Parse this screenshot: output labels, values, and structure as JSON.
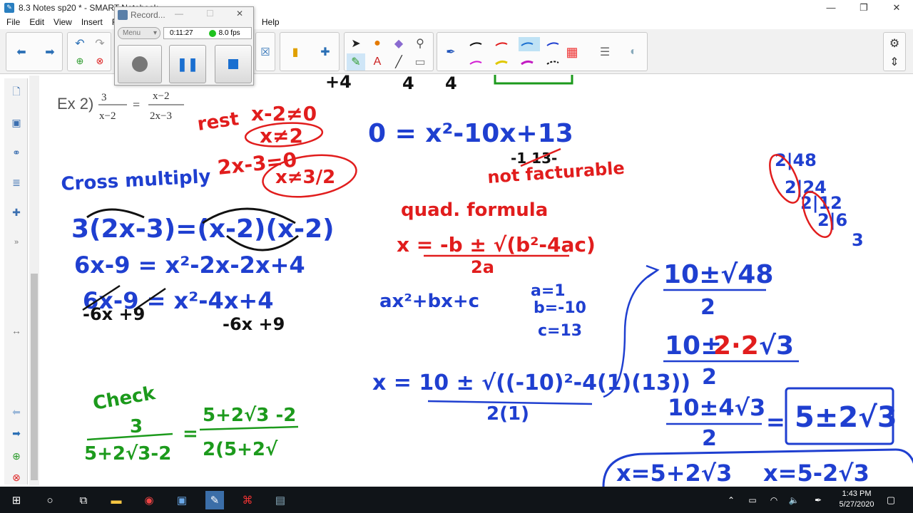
{
  "window": {
    "title": "8.3 Notes sp20 * - SMART Notebook",
    "minimize_glyph": "—",
    "maximize_glyph": "❐",
    "close_glyph": "✕"
  },
  "menu": [
    "File",
    "Edit",
    "View",
    "Insert",
    "Fo",
    "Help"
  ],
  "recorder": {
    "title": "Record...",
    "menu_label": "Menu",
    "time": "0:11:27",
    "fps": "8.0 fps"
  },
  "colors": {
    "ink_blue": "#1f3fd0",
    "ink_red": "#e11d1d",
    "ink_green": "#1c9a1c",
    "ink_black": "#111111"
  },
  "canvas": {
    "example_label": "Ex 2)",
    "eq_left_num": "3",
    "eq_left_den": "x−2",
    "eq_equals": "=",
    "eq_right_num": "x−2",
    "eq_right_den": "2x−3",
    "top_fragments": [
      "4",
      "+4",
      "4",
      "4"
    ],
    "restrictions": {
      "rest": "rest",
      "line1": "x-2≠0",
      "ans1": "x≠2",
      "line2": "2x-3=0",
      "ans2": "x≠3/2"
    },
    "cross": {
      "label": "Cross multiply",
      "l1": "3(2x-3)=(x-2)(x-2)",
      "l2": "6x-9 = x²-2x-2x+4",
      "l3": "6x-9 = x²-4x+4",
      "l4a": "-6x +9",
      "l4b": "-6x +9"
    },
    "quad": {
      "eq": "0 = x²-10x+13",
      "factor": "-1 13-",
      "not_fact": "not facturable",
      "label": "quad. formula",
      "formula_num": "x = -b ± √(b²-4ac)",
      "formula_den": "2a",
      "general": "ax²+bx+c",
      "a": "a=1",
      "b": "b=-10",
      "c": "c=13",
      "sub_num": "x = 10 ± √((-10)²-4(1)(13))",
      "sub_den": "2(1)"
    },
    "factor_tree": [
      "2|48",
      "2|24",
      "2|12",
      "2|6",
      "3"
    ],
    "simplify": {
      "s1_num": "10±√48",
      "s1_den": "2",
      "s2_a": "10±",
      "s2_b": "2·2",
      "s2_c": "√3",
      "s2_den": "2",
      "s3_num": "10±4√3",
      "s3_den": "2",
      "s3_eq": "=",
      "boxed": "5±2√3",
      "final1": "x=5+2√3",
      "final2": "x=5-2√3"
    },
    "check": {
      "label": "Check",
      "num": "3",
      "den": "5+2√3-2",
      "eq": "=",
      "rnum": "5+2√3 -2",
      "rden": "2(5+2√"
    }
  },
  "clock": {
    "time": "1:43 PM",
    "date": "5/27/2020"
  }
}
